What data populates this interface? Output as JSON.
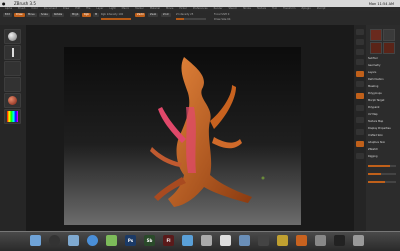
{
  "app": {
    "title": "ZBrush 3.5",
    "clock": "Mon 11:54 AM"
  },
  "menus": [
    "Alpha",
    "Brush",
    "Color",
    "Document",
    "Draw",
    "Edit",
    "File",
    "Layer",
    "Light",
    "Macro",
    "Marker",
    "Material",
    "Movie",
    "Picker",
    "Preferences",
    "Render",
    "Stencil",
    "Stroke",
    "Texture",
    "Tool",
    "Transform",
    "Zplugin",
    "Zscript"
  ],
  "toolbar": {
    "edit_label": "Edit",
    "draw_label": "Draw",
    "move_label": "Move",
    "scale_label": "Scale",
    "rotate_label": "Rotate",
    "mrgb_label": "Mrgb",
    "rgb_label": "Rgb",
    "m_label": "M",
    "zadd_label": "Zadd",
    "zsub_label": "Zsub",
    "zcut_label": "Zcut",
    "focal_shift_label": "Focal Shift 0",
    "draw_size_label": "Draw Size 64",
    "rgb_intensity_label": "Rgb Intensity 100",
    "z_intensity_label": "Z Intensity 25",
    "rgb_intensity": 1.0,
    "z_intensity": 0.25
  },
  "palette": {
    "items": [
      "SubTool",
      "Geometry",
      "Layers",
      "Deformation",
      "Masking",
      "Polygroups",
      "Morph Target",
      "Polypaint",
      "UV Map",
      "Texture Map",
      "Display Properties",
      "Unified Skin",
      "Adaptive Skin",
      "ZSketch",
      "Rigging"
    ],
    "sliders": [
      0.8,
      0.45,
      0.6
    ]
  },
  "dock": {
    "icons": [
      "finder-icon",
      "dashboard-icon",
      "mail-icon",
      "safari-icon",
      "ichat-icon",
      "photoshop-icon",
      "soundbooth-icon",
      "flash-icon",
      "itunes-icon",
      "preview-icon",
      "ical-icon",
      "iphoto-icon",
      "imovie-icon",
      "garageband-icon",
      "zbrush-icon",
      "system-preferences-icon",
      "terminal-icon",
      "trash-icon"
    ],
    "labels": {
      "photoshop": "Ps",
      "soundbooth": "Sb",
      "flash": "Fl"
    }
  },
  "colors": {
    "accent": "#c0601a",
    "model_orange": "#d2691e",
    "model_pink": "#e0486a"
  }
}
